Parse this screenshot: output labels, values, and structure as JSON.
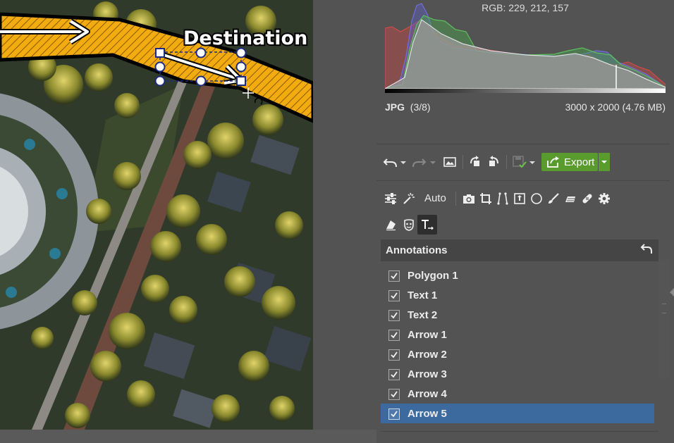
{
  "image_overlay": {
    "destination_text": "Destination"
  },
  "histogram": {
    "rgb_readout": "RGB: 229, 212, 157",
    "colors": {
      "red": "#d24a4a",
      "green": "#5cc05c",
      "blue": "#7070e0",
      "luma": "#9a9a9a"
    }
  },
  "file_info": {
    "format": "JPG",
    "index": "(3/8)",
    "dimensions": "3000 x 2000 (4.76 MB)"
  },
  "toolbar": {
    "export_label": "Export",
    "auto_label": "Auto",
    "accent": "#5a9b2d"
  },
  "annotations_panel": {
    "title": "Annotations",
    "items": [
      {
        "label": "Polygon 1",
        "checked": true,
        "selected": false
      },
      {
        "label": "Text 1",
        "checked": true,
        "selected": false
      },
      {
        "label": "Text 2",
        "checked": true,
        "selected": false
      },
      {
        "label": "Arrow 1",
        "checked": true,
        "selected": false
      },
      {
        "label": "Arrow 2",
        "checked": true,
        "selected": false
      },
      {
        "label": "Arrow 3",
        "checked": true,
        "selected": false
      },
      {
        "label": "Arrow 4",
        "checked": true,
        "selected": false
      },
      {
        "label": "Arrow 5",
        "checked": true,
        "selected": true
      }
    ],
    "selection_color": "#3d6a9e"
  }
}
